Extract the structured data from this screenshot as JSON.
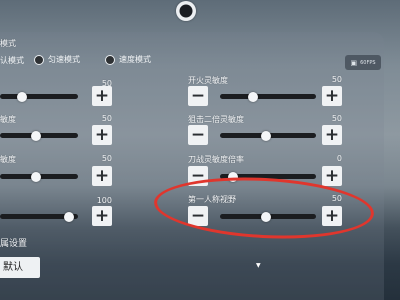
{
  "section_title": "模式",
  "modes": [
    {
      "label": "认模式"
    },
    {
      "label": "匀速模式"
    },
    {
      "label": "速度模式"
    }
  ],
  "fps": {
    "icon": "film-icon",
    "label": "60FPS"
  },
  "left_sliders": [
    {
      "label": "",
      "value": "50",
      "level": 0.5
    },
    {
      "label": "敏度",
      "value": "50",
      "level": 0.5
    },
    {
      "label": "敏度",
      "value": "50",
      "level": 0.5
    },
    {
      "label": "",
      "value": "100",
      "level": 1.0
    }
  ],
  "right_sliders": [
    {
      "label": "开火灵敏度",
      "value": "50",
      "level": 0.5
    },
    {
      "label": "狙击二倍灵敏度",
      "value": "50",
      "level": 0.5
    },
    {
      "label": "刀战灵敏度倍率",
      "value": "0",
      "level": 0.0
    },
    {
      "label": "第一人称视野",
      "value": "50",
      "level": 0.5
    }
  ],
  "buttons": {
    "minus": "−",
    "plus": "+"
  },
  "bottom": {
    "section_label": "属设置",
    "default_button": "默认",
    "dropdown_caret": "▼"
  },
  "highlight_color": "#e0362d"
}
